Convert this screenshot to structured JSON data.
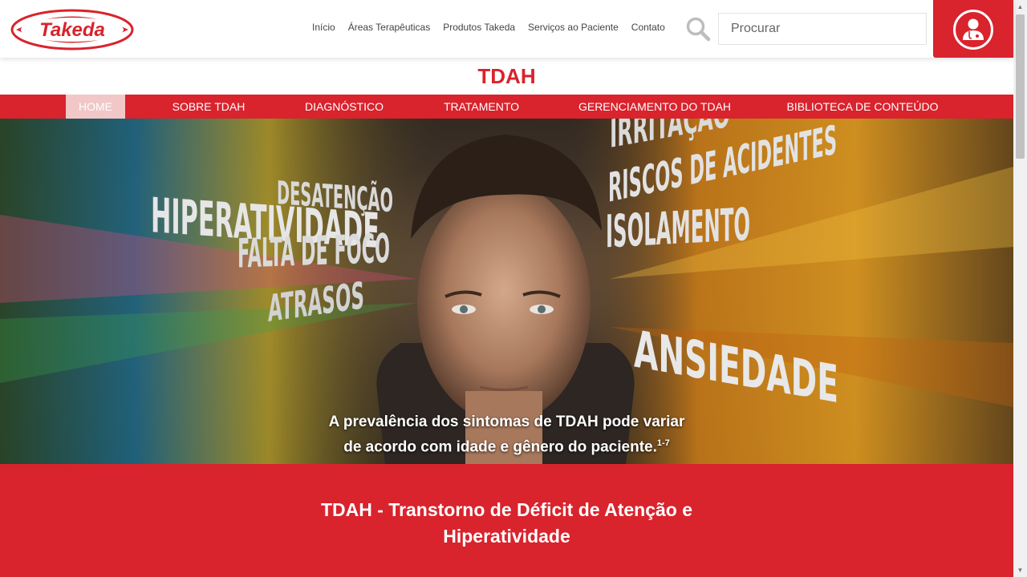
{
  "header": {
    "logo_text": "Takeda",
    "nav": [
      "Início",
      "Áreas Terapêuticas",
      "Produtos Takeda",
      "Serviços ao Paciente",
      "Contato"
    ],
    "search_placeholder": "Procurar"
  },
  "page": {
    "title": "TDAH"
  },
  "subnav": {
    "items": [
      "HOME",
      "SOBRE TDAH",
      "DIAGNÓSTICO",
      "TRATAMENTO",
      "GERENCIAMENTO DO TDAH",
      "BIBLIOTECA DE CONTEÚDO"
    ],
    "active": "HOME"
  },
  "hero": {
    "words_left": [
      "DESATENÇÃO",
      "HIPERATIVIDADE",
      "FALTA DE FOCO",
      "ATRASOS"
    ],
    "words_right": [
      "IRRITAÇÃO",
      "RISCOS DE ACIDENTES",
      "ISOLAMENTO",
      "ANSIEDADE"
    ],
    "caption_line1": "A prevalência dos sintomas de TDAH pode variar",
    "caption_line2": "de acordo com idade e gênero do paciente.",
    "caption_sup": "1-7"
  },
  "intro": {
    "heading": "TDAH - Transtorno de Déficit de Atenção e Hiperatividade"
  },
  "colors": {
    "brand_red": "#d9232d",
    "active_tab": "#f2c7c8"
  }
}
